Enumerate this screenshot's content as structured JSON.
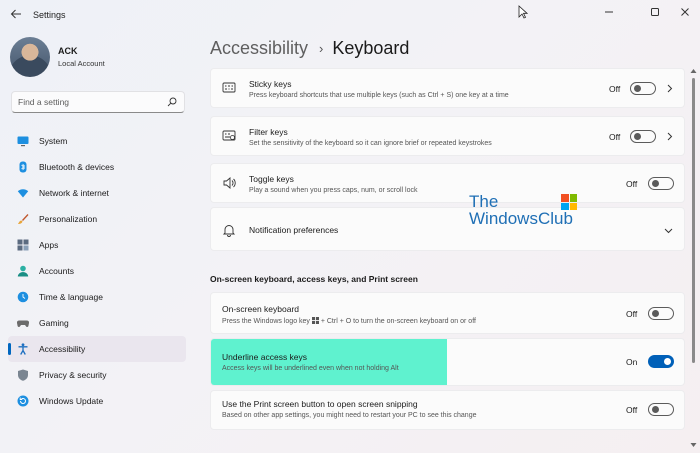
{
  "window": {
    "app_title": "Settings",
    "icons": {
      "back": "back-arrow-icon",
      "minimize": "minimize-icon",
      "maximize": "maximize-icon",
      "close": "close-icon"
    }
  },
  "profile": {
    "name": "ACK",
    "account_type": "Local Account"
  },
  "search": {
    "placeholder": "Find a setting"
  },
  "nav": {
    "items": [
      {
        "label": "System",
        "icon": "monitor-icon",
        "active": false
      },
      {
        "label": "Bluetooth & devices",
        "icon": "bluetooth-icon",
        "active": false
      },
      {
        "label": "Network & internet",
        "icon": "wifi-icon",
        "active": false
      },
      {
        "label": "Personalization",
        "icon": "brush-icon",
        "active": false
      },
      {
        "label": "Apps",
        "icon": "apps-icon",
        "active": false
      },
      {
        "label": "Accounts",
        "icon": "person-icon",
        "active": false
      },
      {
        "label": "Time & language",
        "icon": "globe-clock-icon",
        "active": false
      },
      {
        "label": "Gaming",
        "icon": "gamepad-icon",
        "active": false
      },
      {
        "label": "Accessibility",
        "icon": "accessibility-icon",
        "active": true
      },
      {
        "label": "Privacy & security",
        "icon": "shield-icon",
        "active": false
      },
      {
        "label": "Windows Update",
        "icon": "update-icon",
        "active": false
      }
    ]
  },
  "header": {
    "parent": "Accessibility",
    "separator": "›",
    "current": "Keyboard"
  },
  "settings": {
    "sticky_keys": {
      "title": "Sticky keys",
      "description": "Press keyboard shortcuts that use multiple keys (such as Ctrl + S) one key at a time",
      "state": "Off",
      "on": false
    },
    "filter_keys": {
      "title": "Filter keys",
      "description": "Set the sensitivity of the keyboard so it can ignore brief or repeated keystrokes",
      "state": "Off",
      "on": false
    },
    "toggle_keys": {
      "title": "Toggle keys",
      "description": "Play a sound when you press caps, num, or scroll lock",
      "state": "Off",
      "on": false
    },
    "notification_preferences": {
      "title": "Notification preferences"
    },
    "section_heading": "On-screen keyboard, access keys, and Print screen",
    "onscreen_keyboard": {
      "title": "On-screen keyboard",
      "description_before": "Press the Windows logo key",
      "description_after": "+ Ctrl + O to turn the on-screen keyboard on or off",
      "state": "Off",
      "on": false
    },
    "underline_access_keys": {
      "title": "Underline access keys",
      "description": "Access keys will be underlined even when not holding Alt",
      "state": "On",
      "on": true
    },
    "print_screen": {
      "title": "Use the Print screen button to open screen snipping",
      "description": "Based on other app settings, you might need to restart your PC to see this change",
      "state": "Off",
      "on": false
    }
  },
  "watermark": {
    "line1": "The",
    "line2": "WindowsClub"
  },
  "colors": {
    "accent": "#0060b8",
    "highlight": "#5ff2cf",
    "watermark": "#1f6fb5"
  }
}
